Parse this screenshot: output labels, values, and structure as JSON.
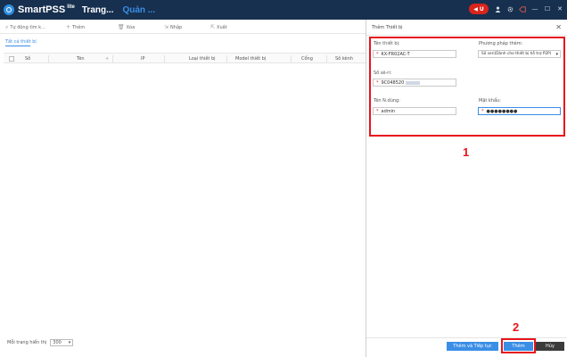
{
  "titlebar": {
    "app_name": "SmartPSS",
    "app_sup": "lite",
    "tab_home": "Trang...",
    "tab_manage": "Quản ...",
    "rec_badge": "U",
    "icons": [
      "record-pill-icon",
      "user-icon",
      "gear-icon",
      "tag-icon",
      "minimize-icon",
      "maximize-icon",
      "close-icon"
    ],
    "min": "—",
    "max": "☐",
    "close": "✕"
  },
  "toolbar": {
    "auto_search": "Tự động tìm k...",
    "add": "Thêm",
    "delete": "Xóa",
    "import": "Nhập",
    "export": "Xuất"
  },
  "subtab": "Tất cả thiết bị",
  "table": {
    "headers": [
      "Số",
      "Tên",
      "IP",
      "Loại thiết bị",
      "Model thiết bị",
      "Cổng",
      "Số kênh"
    ]
  },
  "footer": {
    "page_size_label": "Mỗi trang hiển thị",
    "page_size_value": "300"
  },
  "panel": {
    "title": "Thêm Thiết bị",
    "close": "✕",
    "device_name_label": "Tên thiết bị:",
    "device_name_value": "KX-FR02AC-T",
    "add_method_label": "Phương pháp thêm:",
    "add_method_value": "Số seri(Dành cho thiết bị hỗ trợ P2P)",
    "serial_label": "Số sê-ri:",
    "serial_value": "9C048520",
    "username_label": "Tên N.dùng:",
    "username_value": "admin",
    "password_label": "Mật khẩu:",
    "password_value": "●●●●●●●●",
    "required_mark": "*",
    "btn_add_continue": "Thêm và Tiếp tục",
    "btn_add": "Thêm",
    "btn_cancel": "Hủy"
  },
  "annotations": {
    "label1": "1",
    "label2": "2"
  },
  "colors": {
    "titlebar_bg": "#17304f",
    "accent": "#3a8ee6",
    "highlight_red": "#e8141c",
    "cancel_bg": "#3b3b3b"
  }
}
